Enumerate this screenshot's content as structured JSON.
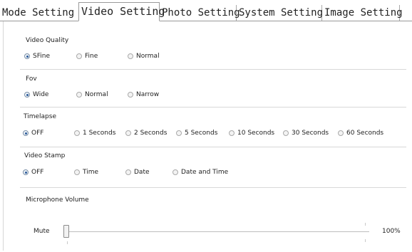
{
  "tabs": [
    {
      "label": "Mode Setting"
    },
    {
      "label": "Video Setting",
      "active": true
    },
    {
      "label": "Photo Setting"
    },
    {
      "label": "System Setting"
    },
    {
      "label": "Image Setting"
    }
  ],
  "video_quality": {
    "title": "Video Quality",
    "options": [
      "SFine",
      "Fine",
      "Normal"
    ],
    "selected": "SFine"
  },
  "fov": {
    "title": "Fov",
    "options": [
      "Wide",
      "Normal",
      "Narrow"
    ],
    "selected": "Wide"
  },
  "timelapse": {
    "title": "Timelapse",
    "options": [
      "OFF",
      "1 Seconds",
      "2 Seconds",
      "5 Seconds",
      "10 Seconds",
      "30 Seconds",
      "60 Seconds"
    ],
    "selected": "OFF"
  },
  "video_stamp": {
    "title": "Video Stamp",
    "options": [
      "OFF",
      "Time",
      "Date",
      "Date and Time"
    ],
    "selected": "OFF"
  },
  "microphone": {
    "title": "Microphone Volume",
    "min_label": "Mute",
    "max_label": "100%",
    "value_fraction": 0.0
  },
  "colors": {
    "radio_selected": "#2a5a9a",
    "separator": "#d8d8d8"
  }
}
